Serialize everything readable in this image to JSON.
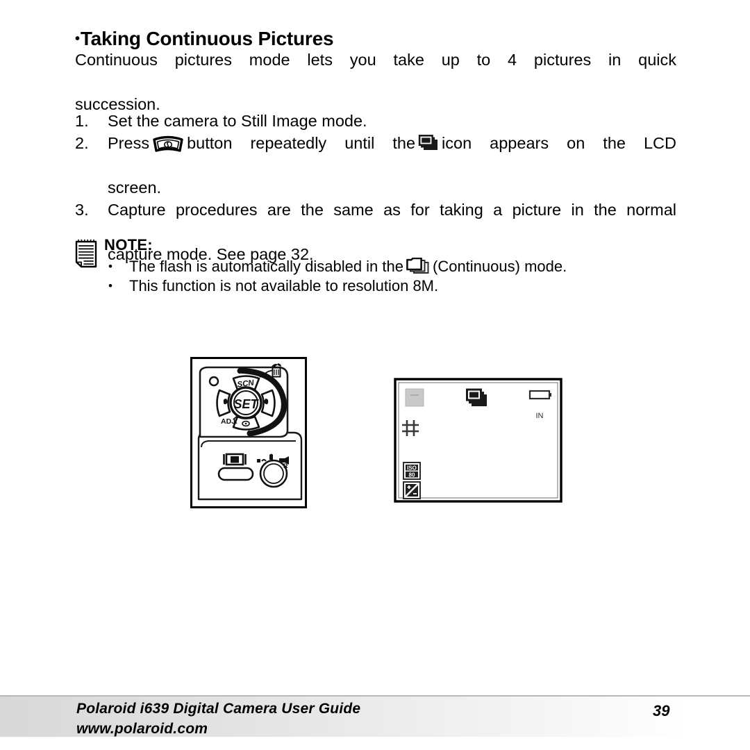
{
  "heading": {
    "bullet": "•",
    "text": "Taking Continuous Pictures"
  },
  "intro": {
    "line1": "Continuous pictures mode lets you take up to 4 pictures in quick",
    "line2": "succession."
  },
  "steps": [
    {
      "number": "1.",
      "text": "Set the camera to Still Image mode."
    },
    {
      "number": "2.",
      "text_before": "Press",
      "icon1": "mode-button-icon",
      "text_middle": "button repeatedly until the",
      "icon2": "continuous-burst-icon",
      "text_after": "icon appears on the LCD",
      "text_line2": "screen."
    },
    {
      "number": "3.",
      "text_line1": "Capture procedures are the same as for taking a picture in the normal",
      "text_line2": "capture mode. See page 32."
    }
  ],
  "note": {
    "icon": "notepad-icon",
    "title": "NOTE:",
    "items": [
      {
        "bullet": "•",
        "text_before": "The flash is automatically disabled in the",
        "icon": "continuous-burst-outline-icon",
        "text_after": "(Continuous) mode."
      },
      {
        "bullet": "•",
        "text_before": "This function is not available to resolution 8M.",
        "icon": "",
        "text_after": ""
      }
    ]
  },
  "figures": {
    "camera": {
      "name": "camera-back-panel-diagram",
      "labels": {
        "set": "SET",
        "scn": "SCN",
        "adj": "ADJ."
      }
    },
    "lcd": {
      "name": "lcd-screen-diagram",
      "indicators": {
        "memory": "IN",
        "iso_label": "ISO",
        "iso_value": "80"
      }
    }
  },
  "footer": {
    "title": "Polaroid i639 Digital Camera User Guide",
    "website": "www.polaroid.com",
    "page_number": "39"
  }
}
